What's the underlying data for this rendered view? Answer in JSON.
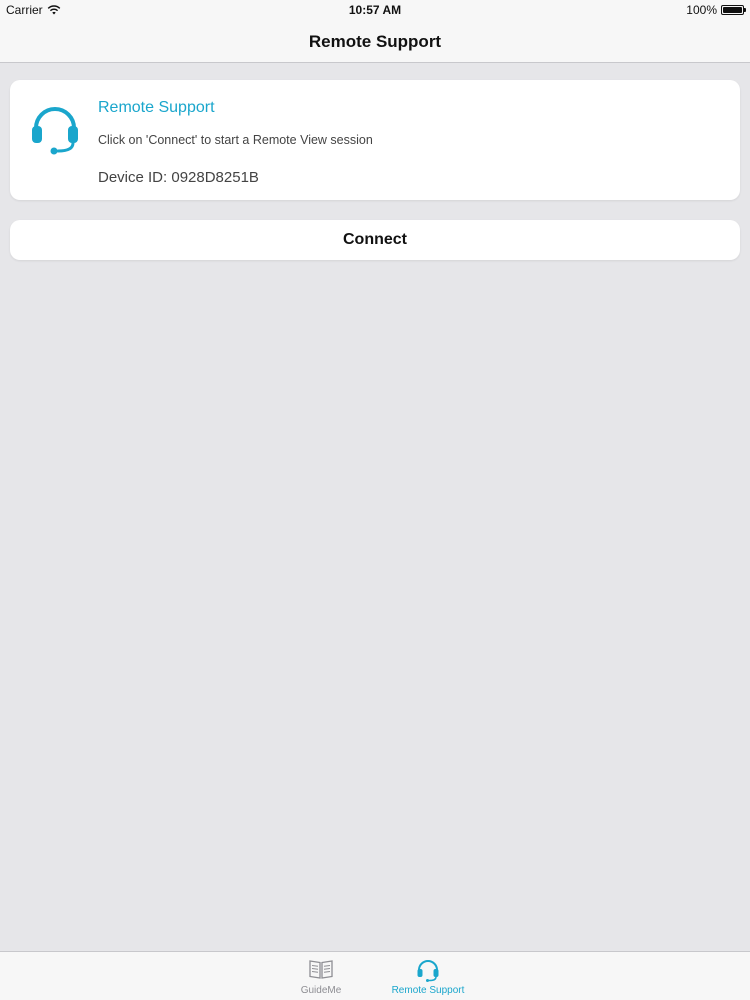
{
  "status_bar": {
    "carrier": "Carrier",
    "time": "10:57 AM",
    "battery": "100%",
    "wifi_icon": "wifi-icon",
    "battery_icon": "battery-icon"
  },
  "nav": {
    "title": "Remote Support"
  },
  "card": {
    "icon": "headset-icon",
    "title": "Remote Support",
    "instruction": "Click on 'Connect' to start a Remote View session",
    "device_id": "Device ID: 0928D8251B"
  },
  "connect_button": {
    "label": "Connect"
  },
  "tabs": [
    {
      "label": "GuideMe",
      "icon": "book-icon",
      "selected": false
    },
    {
      "label": "Remote Support",
      "icon": "headset-icon",
      "selected": true
    }
  ],
  "colors": {
    "accent": "#1aa6cc",
    "background": "#e6e6e9",
    "bar": "#f7f7f7",
    "card": "#ffffff",
    "inactive_tab": "#8e8e93"
  }
}
